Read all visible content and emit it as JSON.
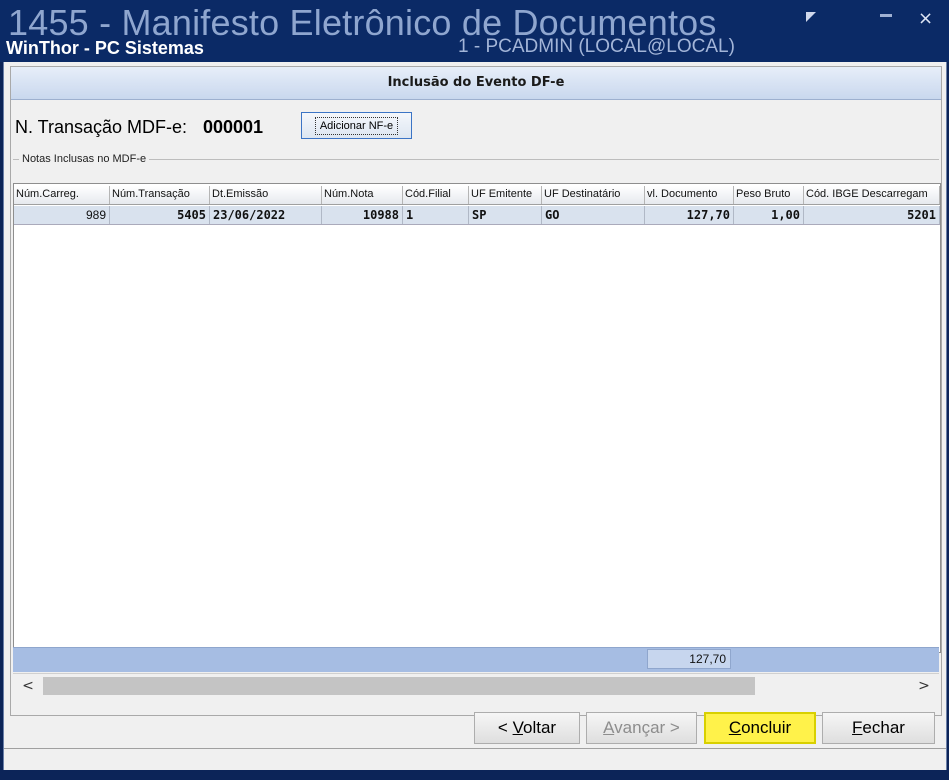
{
  "window": {
    "title": "1455 - Manifesto Eletrônico de Documentos",
    "app_name": "WinThor - PC Sistemas",
    "user": "1 - PCADMIN (LOCAL@LOCAL)",
    "close_glyph": "×"
  },
  "header": {
    "title": "Inclusão do Evento DF-e"
  },
  "transaction": {
    "label": "N. Transação MDF-e:",
    "value": "000001"
  },
  "add_button": {
    "label": "Adicionar NF-e"
  },
  "group": {
    "label": "Notas Inclusas no MDF-e"
  },
  "grid": {
    "columns": [
      "Núm.Carreg.",
      "Núm.Transação",
      "Dt.Emissão",
      "Núm.Nota",
      "Cód.Filial",
      "UF Emitente",
      "UF Destinatário",
      "vl. Documento",
      "Peso Bruto",
      "Cód. IBGE Descarregam"
    ],
    "rows": [
      [
        "989",
        "5405",
        "23/06/2022",
        "10988",
        "1",
        "SP",
        "GO",
        "127,70",
        "1,00",
        "5201"
      ]
    ],
    "total": "127,70"
  },
  "scroll": {
    "left_glyph": "<",
    "right_glyph": ">"
  },
  "buttons": {
    "back": {
      "prefix": "< ",
      "accel": "V",
      "rest": "oltar"
    },
    "next": {
      "accel": "A",
      "rest": "vançar >"
    },
    "done": {
      "accel": "C",
      "rest": "oncluir"
    },
    "close": {
      "accel": "F",
      "rest": "echar"
    }
  },
  "colors": {
    "title_bar": "#0b2a66",
    "header_bg": "#c9d8ee",
    "selected_row": "#d9e2ee",
    "total_bar": "#a6bde3",
    "highlight": "#fff24a"
  }
}
